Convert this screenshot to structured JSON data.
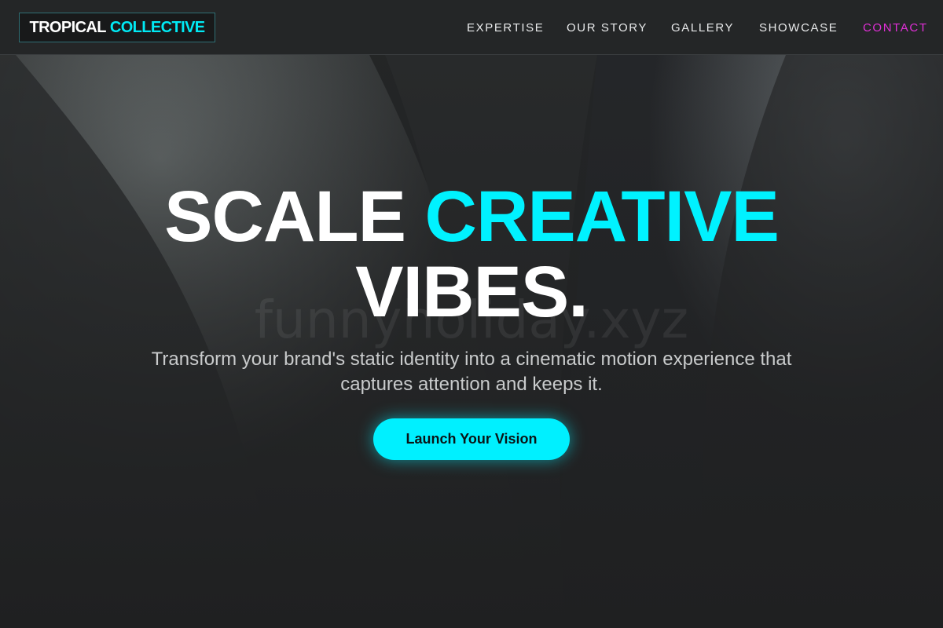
{
  "header": {
    "logo": {
      "part1": "TROPICAL",
      "part2": "COLLECTIVE"
    },
    "nav": [
      {
        "label": "EXPERTISE"
      },
      {
        "label": "OUR STORY"
      },
      {
        "label": "GALLERY"
      },
      {
        "label": "SHOWCASE"
      },
      {
        "label": "CONTACT"
      }
    ]
  },
  "hero": {
    "headline_part1": "SCALE",
    "headline_accent": "CREATIVE",
    "headline_line2": "VIBES.",
    "watermark": "funnyholiday.xyz",
    "subtitle": "Transform your brand's static identity into a cinematic motion experience that captures attention and keeps it.",
    "cta_label": "Launch Your Vision"
  },
  "colors": {
    "accent_cyan": "#00f2ff",
    "contact_magenta": "#e02fd6",
    "background": "#1f2021",
    "header": "#242627"
  }
}
